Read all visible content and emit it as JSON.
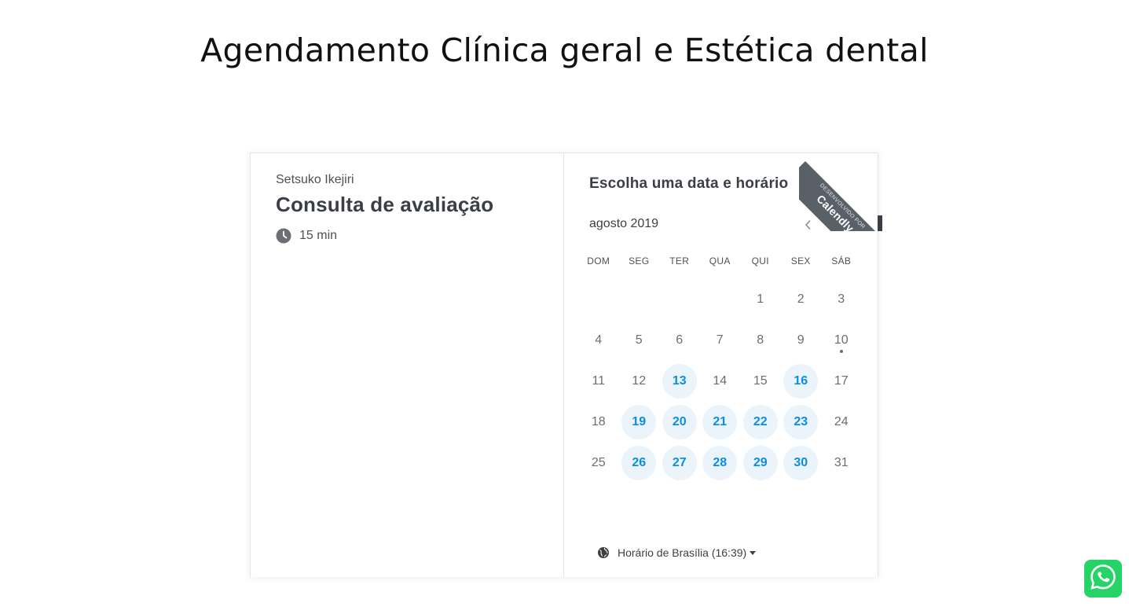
{
  "page": {
    "title": "Agendamento Clínica geral e Estética dental"
  },
  "event": {
    "host": "Setsuko Ikejiri",
    "name": "Consulta de avaliação",
    "duration": "15 min",
    "clock_icon": "clock-icon"
  },
  "calendar": {
    "heading": "Escolha uma data e horário",
    "month": "agosto 2019",
    "prev_icon": "chevron-left-icon",
    "next_icon": "chevron-right-icon",
    "weekdays": [
      "DOM",
      "SEG",
      "TER",
      "QUA",
      "QUI",
      "SEX",
      "SÁB"
    ],
    "weeks": [
      [
        {
          "d": ""
        },
        {
          "d": ""
        },
        {
          "d": ""
        },
        {
          "d": ""
        },
        {
          "d": "1"
        },
        {
          "d": "2"
        },
        {
          "d": "3"
        }
      ],
      [
        {
          "d": "4"
        },
        {
          "d": "5"
        },
        {
          "d": "6"
        },
        {
          "d": "7"
        },
        {
          "d": "8"
        },
        {
          "d": "9"
        },
        {
          "d": "10",
          "today": true
        }
      ],
      [
        {
          "d": "11"
        },
        {
          "d": "12"
        },
        {
          "d": "13",
          "available": true
        },
        {
          "d": "14"
        },
        {
          "d": "15"
        },
        {
          "d": "16",
          "available": true
        },
        {
          "d": "17"
        }
      ],
      [
        {
          "d": "18"
        },
        {
          "d": "19",
          "available": true
        },
        {
          "d": "20",
          "available": true
        },
        {
          "d": "21",
          "available": true
        },
        {
          "d": "22",
          "available": true
        },
        {
          "d": "23",
          "available": true
        },
        {
          "d": "24"
        }
      ],
      [
        {
          "d": "25"
        },
        {
          "d": "26",
          "available": true
        },
        {
          "d": "27",
          "available": true
        },
        {
          "d": "28",
          "available": true
        },
        {
          "d": "29",
          "available": true
        },
        {
          "d": "30",
          "available": true
        },
        {
          "d": "31"
        }
      ]
    ],
    "timezone": "Horário de Brasília (16:39)",
    "timezone_icon": "globe-icon"
  },
  "badge": {
    "small": "DESENVOLVIDO POR",
    "brand": "Calendly"
  },
  "whatsapp": {
    "icon": "whatsapp-icon"
  },
  "colors": {
    "available_bg": "#ebf4fb",
    "available_text": "#0b8ee0",
    "badge": "#5a6068",
    "whatsapp": "#25d366"
  }
}
